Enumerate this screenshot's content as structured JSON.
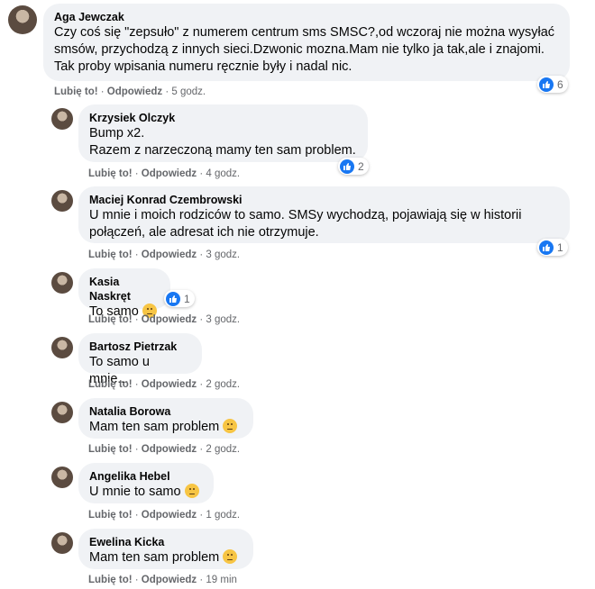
{
  "actions": {
    "like": "Lubię to!",
    "reply": "Odpowiedz",
    "sep": "·"
  },
  "comments": [
    {
      "author": "Aga Jewczak",
      "text": "Czy coś się \"zepsuło\" z numerem centrum sms SMSC?,od wczoraj nie można wysyłać\nsmsów, przychodzą z innych sieci.Dzwonic mozna.Mam nie tylko ja tak,ale i znajomi.\nTak proby wpisania numeru ręcznie były i nadal nic.",
      "time": "5 godz.",
      "reactions": "6"
    },
    {
      "author": "Krzysiek Olczyk",
      "text": "Bump x2.\nRazem z narzeczoną mamy ten sam problem.",
      "time": "4 godz.",
      "reactions": "2"
    },
    {
      "author": "Maciej Konrad Czembrowski",
      "text": "U mnie i moich rodziców to samo. SMSy wychodzą, pojawiają się w historii\npołączeń, ale adresat ich nie otrzymuje.",
      "time": "3 godz.",
      "reactions": "1"
    },
    {
      "author": "Kasia Naskręt",
      "text": "To samo",
      "emoji": "worried-face-emoji",
      "time": "3 godz.",
      "reactions": "1"
    },
    {
      "author": "Bartosz Pietrzak",
      "text": "To samo u mnie...",
      "time": "2 godz."
    },
    {
      "author": "Natalia Borowa",
      "text": "Mam ten sam problem",
      "emoji": "pensive-face-emoji",
      "time": "2 godz."
    },
    {
      "author": "Angelika Hebel",
      "text": "U mnie to samo",
      "emoji": "rolling-eyes-emoji",
      "time": "1 godz."
    },
    {
      "author": "Ewelina Kicka",
      "text": "Mam ten sam problem",
      "emoji": "steam-face-emoji",
      "time": "19 min"
    }
  ],
  "colors": {
    "bubble": "#f0f2f5",
    "like_blue": "#1877f2",
    "meta": "#65676b"
  }
}
